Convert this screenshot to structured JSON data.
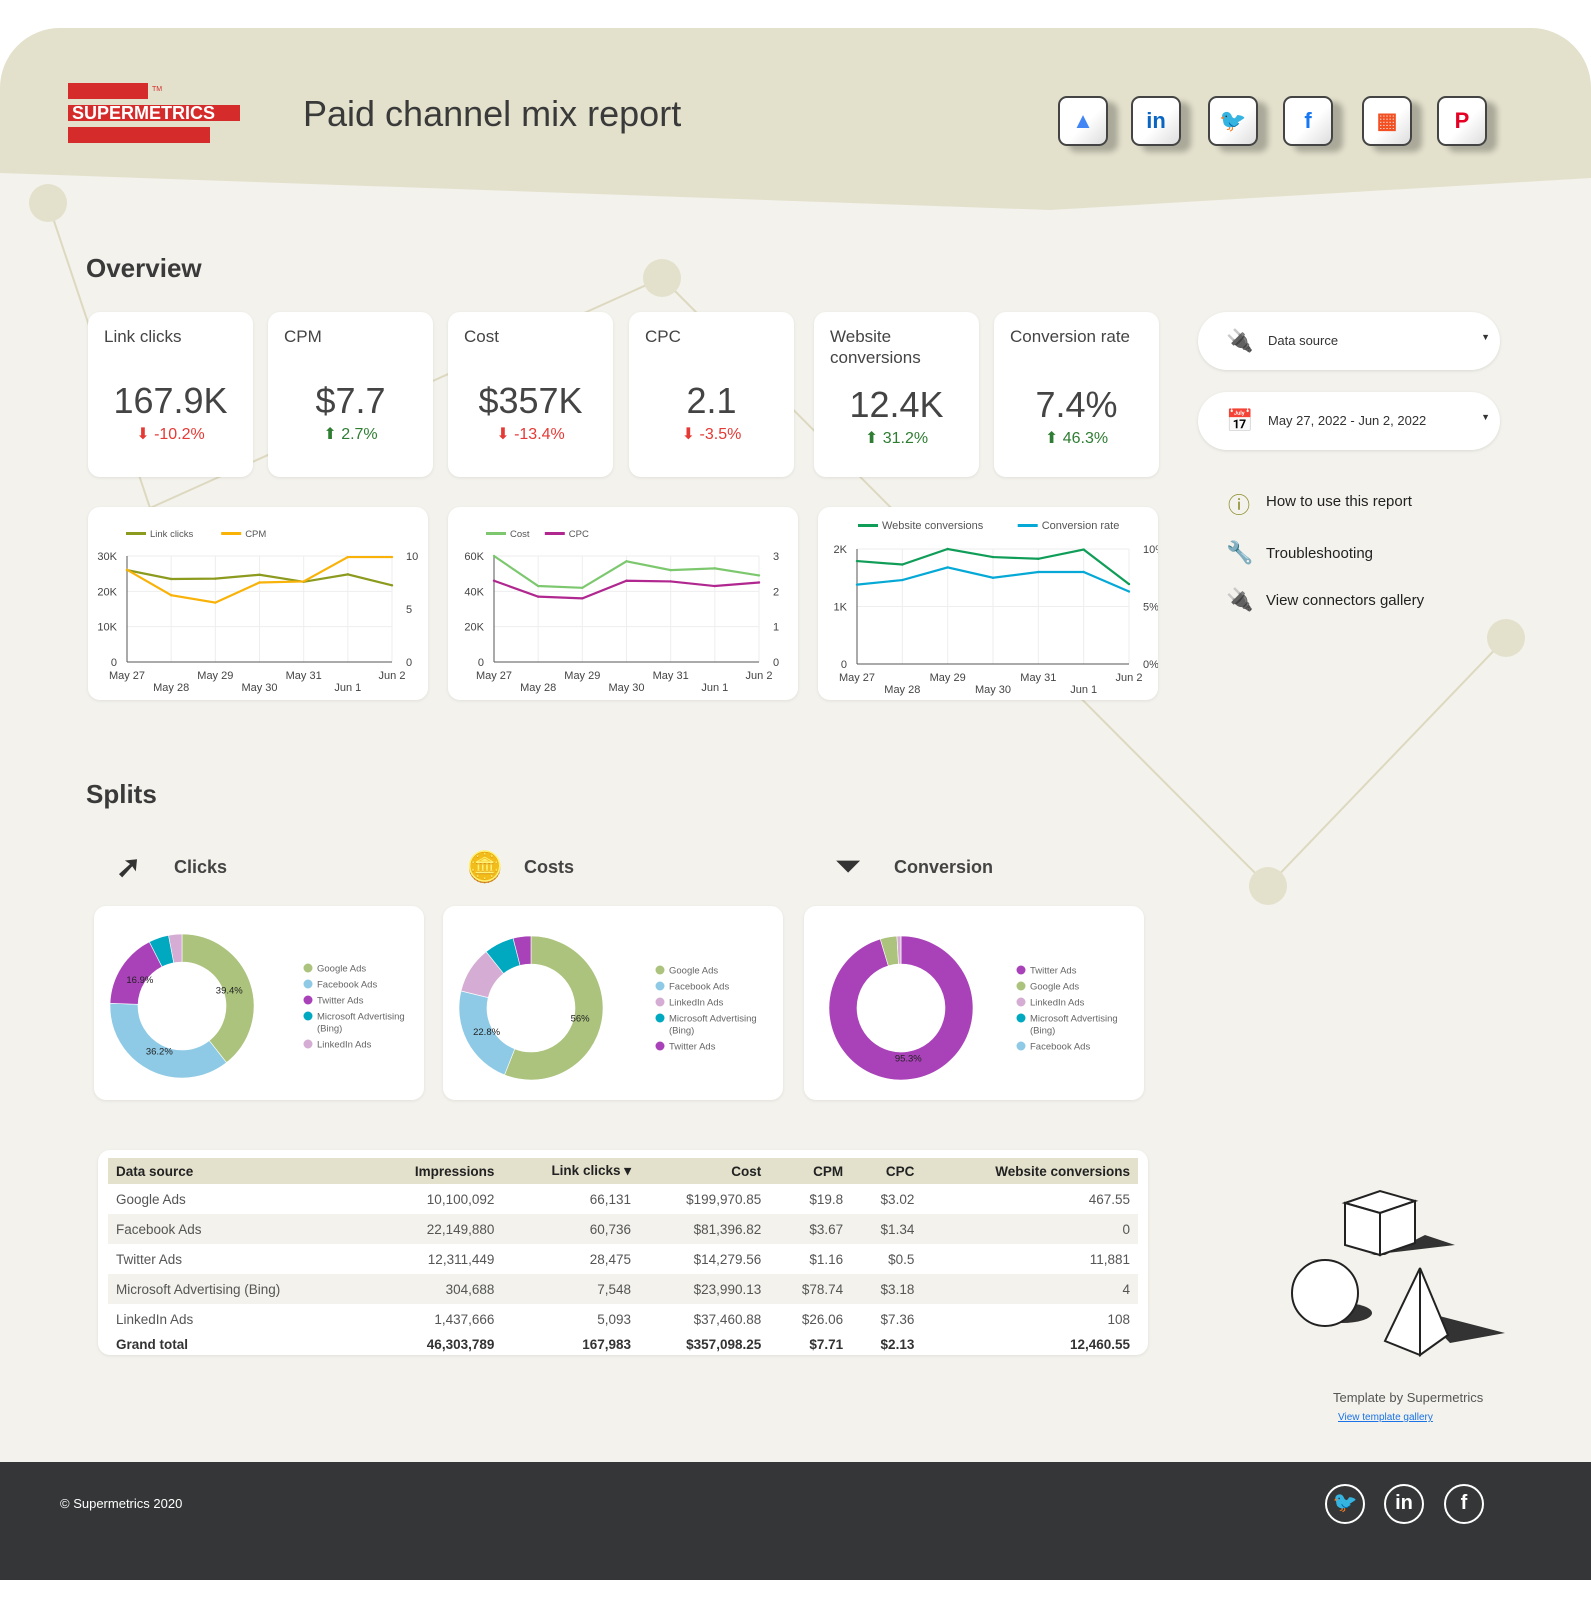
{
  "header": {
    "title": "Paid channel mix report",
    "logo_text": "SUPERMETRICS",
    "logo_tm": "TM",
    "connectors": [
      {
        "name": "google-ads",
        "glyph": "▲",
        "color": "#4285f4"
      },
      {
        "name": "linkedin",
        "glyph": "in",
        "color": "#0a66c2"
      },
      {
        "name": "twitter",
        "glyph": "🐦",
        "color": "#1da1f2"
      },
      {
        "name": "facebook",
        "glyph": "f",
        "color": "#1877f2"
      },
      {
        "name": "microsoft",
        "glyph": "▦",
        "color": "#f25022"
      },
      {
        "name": "pinterest",
        "glyph": "P",
        "color": "#e60023"
      }
    ]
  },
  "overview": {
    "heading": "Overview",
    "kpis": [
      {
        "label": "Link clicks",
        "value": "167.9K",
        "change": "-10.2%",
        "dir": "down"
      },
      {
        "label": "CPM",
        "value": "$7.7",
        "change": "2.7%",
        "dir": "up"
      },
      {
        "label": "Cost",
        "value": "$357K",
        "change": "-13.4%",
        "dir": "down"
      },
      {
        "label": "CPC",
        "value": "2.1",
        "change": "-3.5%",
        "dir": "down"
      },
      {
        "label": "Website conversions",
        "value": "12.4K",
        "change": "31.2%",
        "dir": "up"
      },
      {
        "label": "Conversion rate",
        "value": "7.4%",
        "change": "46.3%",
        "dir": "up"
      }
    ]
  },
  "controls": {
    "data_source": "Data source",
    "date_range": "May 27, 2022 - Jun 2, 2022"
  },
  "links": [
    {
      "label": "How to use this report",
      "icon": "info-icon"
    },
    {
      "label": "Troubleshooting",
      "icon": "wrench-icon"
    },
    {
      "label": "View connectors gallery",
      "icon": "plug-icon"
    }
  ],
  "chart_data": [
    {
      "type": "line",
      "x": [
        "May 27",
        "May 28",
        "May 29",
        "May 30",
        "May 31",
        "Jun 1",
        "Jun 2"
      ],
      "ylim": [
        0,
        30000
      ],
      "y2lim": [
        0,
        10
      ],
      "yticks": [
        "0",
        "10K",
        "20K",
        "30K"
      ],
      "y2ticks": [
        "0",
        "5",
        "10"
      ],
      "legend": "top-left",
      "grid": true,
      "series": [
        {
          "name": "Link clicks",
          "axis": "left",
          "color": "#8c9a1e",
          "values": [
            26000,
            23500,
            23600,
            24700,
            22700,
            24800,
            21700
          ]
        },
        {
          "name": "CPM",
          "axis": "right",
          "color": "#f9b208",
          "values": [
            8.7,
            6.3,
            5.6,
            7.5,
            7.6,
            9.9,
            9.9
          ]
        }
      ]
    },
    {
      "type": "line",
      "x": [
        "May 27",
        "May 28",
        "May 29",
        "May 30",
        "May 31",
        "Jun 1",
        "Jun 2"
      ],
      "ylim": [
        0,
        60000
      ],
      "y2lim": [
        0,
        3
      ],
      "yticks": [
        "0",
        "20K",
        "40K",
        "60K"
      ],
      "y2ticks": [
        "0",
        "1",
        "2",
        "3"
      ],
      "legend": "top-left",
      "grid": true,
      "series": [
        {
          "name": "Cost",
          "axis": "left",
          "color": "#7dc86f",
          "values": [
            60000,
            43000,
            42000,
            57000,
            52000,
            53000,
            49000
          ]
        },
        {
          "name": "CPC",
          "axis": "right",
          "color": "#b0278f",
          "values": [
            2.3,
            1.85,
            1.8,
            2.3,
            2.28,
            2.15,
            2.25
          ]
        }
      ]
    },
    {
      "type": "line",
      "x": [
        "May 27",
        "May 28",
        "May 29",
        "May 30",
        "May 31",
        "Jun 1",
        "Jun 2"
      ],
      "ylim": [
        0,
        2000
      ],
      "y2lim": [
        0,
        10
      ],
      "yticks": [
        "0",
        "1K",
        "2K"
      ],
      "y2ticks": [
        "0%",
        "5%",
        "10%"
      ],
      "legend": "top-left",
      "grid": true,
      "series": [
        {
          "name": "Website conversions",
          "axis": "left",
          "color": "#0f9d58",
          "values": [
            1790,
            1730,
            2000,
            1860,
            1830,
            1990,
            1390
          ]
        },
        {
          "name": "Conversion rate",
          "axis": "right",
          "color": "#06a9d6",
          "values": [
            6.9,
            7.3,
            8.4,
            7.5,
            8.0,
            8.0,
            6.3
          ]
        }
      ]
    },
    {
      "type": "pie",
      "title": "Clicks",
      "labels": [
        "Google Ads",
        "Facebook Ads",
        "Twitter Ads",
        "Microsoft Advertising (Bing)",
        "LinkedIn Ads"
      ],
      "values": [
        39.4,
        36.2,
        16.9,
        4.5,
        3.0
      ],
      "colors": [
        "#abc37d",
        "#8ecae6",
        "#a942b9",
        "#00a9c0",
        "#d5acd3"
      ],
      "shown_labels": [
        "39.4%",
        "36.2%",
        "16.9%",
        "",
        ""
      ]
    },
    {
      "type": "pie",
      "title": "Costs",
      "labels": [
        "Google Ads",
        "Facebook Ads",
        "LinkedIn Ads",
        "Microsoft Advertising (Bing)",
        "Twitter Ads"
      ],
      "values": [
        56,
        22.8,
        10.5,
        6.7,
        4.0
      ],
      "colors": [
        "#abc37d",
        "#8ecae6",
        "#d5acd3",
        "#00a9c0",
        "#a942b9"
      ],
      "shown_labels": [
        "56%",
        "22.8%",
        "",
        "",
        ""
      ]
    },
    {
      "type": "pie",
      "title": "Conversion",
      "labels": [
        "Twitter Ads",
        "Google Ads",
        "LinkedIn Ads",
        "Microsoft Advertising (Bing)",
        "Facebook Ads"
      ],
      "values": [
        95.3,
        3.75,
        0.87,
        0.03,
        0
      ],
      "colors": [
        "#a942b9",
        "#abc37d",
        "#d5acd3",
        "#00a9c0",
        "#8ecae6"
      ],
      "shown_labels": [
        "95.3%",
        "",
        "",
        "",
        ""
      ]
    }
  ],
  "splits": {
    "heading": "Splits"
  },
  "table": {
    "columns": [
      "Data source",
      "Impressions",
      "Link clicks ▾",
      "Cost",
      "CPM",
      "CPC",
      "Website conversions"
    ],
    "rows": [
      [
        "Google Ads",
        "10,100,092",
        "66,131",
        "$199,970.85",
        "$19.8",
        "$3.02",
        "467.55"
      ],
      [
        "Facebook Ads",
        "22,149,880",
        "60,736",
        "$81,396.82",
        "$3.67",
        "$1.34",
        "0"
      ],
      [
        "Twitter Ads",
        "12,311,449",
        "28,475",
        "$14,279.56",
        "$1.16",
        "$0.5",
        "11,881"
      ],
      [
        "Microsoft Advertising (Bing)",
        "304,688",
        "7,548",
        "$23,990.13",
        "$78.74",
        "$3.18",
        "4"
      ],
      [
        "LinkedIn Ads",
        "1,437,666",
        "5,093",
        "$37,460.88",
        "$26.06",
        "$7.36",
        "108"
      ]
    ],
    "total": [
      "Grand total",
      "46,303,789",
      "167,983",
      "$357,098.25",
      "$7.71",
      "$2.13",
      "12,460.55"
    ]
  },
  "credit": {
    "text": "Template by Supermetrics",
    "link": "View template gallery"
  },
  "footer": {
    "copyright": "© Supermetrics 2020"
  }
}
